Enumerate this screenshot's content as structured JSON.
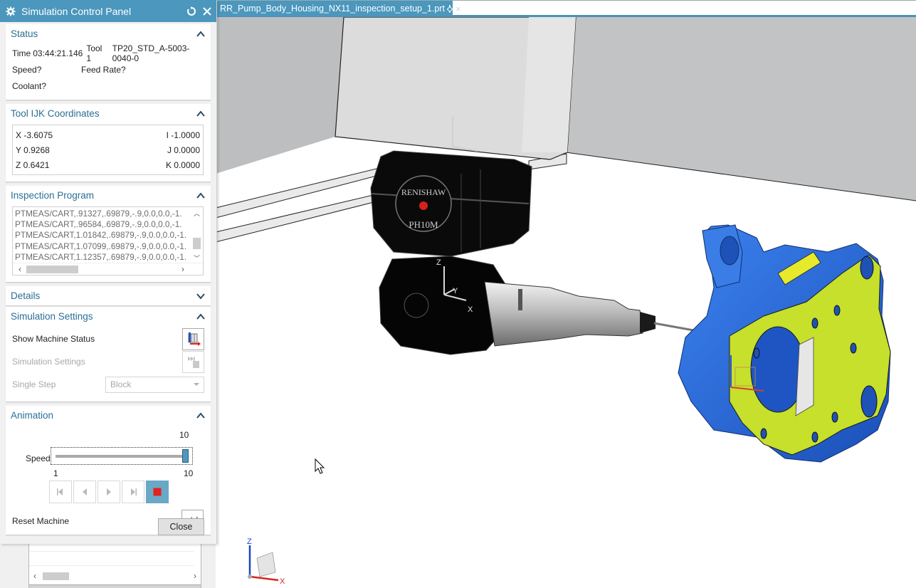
{
  "document_tab": {
    "title": "RR_Pump_Body_Housing_NX11_inspection_setup_1.prt",
    "close_glyph": "×"
  },
  "panel": {
    "title": "Simulation Control Panel",
    "status": {
      "header": "Status",
      "time_label": "Time",
      "time_value": "03:44:21.146",
      "tool_label": "Tool 1",
      "tool_value": "TP20_STD_A-5003-0040-0",
      "speed": "Speed?",
      "feed_rate": "Feed Rate?",
      "coolant": "Coolant?"
    },
    "tool_ijk": {
      "header": "Tool IJK Coordinates",
      "x": "X -3.6075",
      "y": "Y 0.9268",
      "z": "Z 0.6421",
      "i": "I -1.0000",
      "j": "J 0.0000",
      "k": "K 0.0000"
    },
    "inspection_program": {
      "header": "Inspection Program",
      "lines": [
        "PTMEAS/CART,.91327,.69879,-.9,0.0,0.0,-1.",
        "PTMEAS/CART,.96584,.69879,-.9,0.0,0.0,-1.",
        "PTMEAS/CART,1.01842,.69879,-.9,0.0,0.0,-1.",
        "PTMEAS/CART,1.07099,.69879,-.9,0.0,0.0,-1.",
        "PTMEAS/CART,1.12357,.69879,-.9,0.0,0.0,-1."
      ]
    },
    "details": {
      "header": "Details"
    },
    "simulation_settings": {
      "header": "Simulation Settings",
      "show_machine_status": "Show Machine Status",
      "simulation_settings_label": "Simulation Settings",
      "single_step_label": "Single Step",
      "single_step_value": "Block"
    },
    "animation": {
      "header": "Animation",
      "speed_label": "Speed",
      "speed_value": "10",
      "speed_min": "1",
      "speed_max": "10",
      "speed_fraction": 1.0,
      "reset_machine": "Reset Machine"
    },
    "close_button": "Close"
  },
  "viewport": {
    "probe_brand": "RENISHAW",
    "probe_model": "PH10M",
    "csys_labels": {
      "x": "X",
      "y": "Y",
      "z": "Z"
    },
    "triad_labels": {
      "x": "X",
      "z": "Z"
    },
    "colors": {
      "part_blue": "#2f6fe0",
      "part_face": "#c6e02c",
      "accent": "#4b97bd",
      "stop_red": "#e0231b"
    }
  }
}
